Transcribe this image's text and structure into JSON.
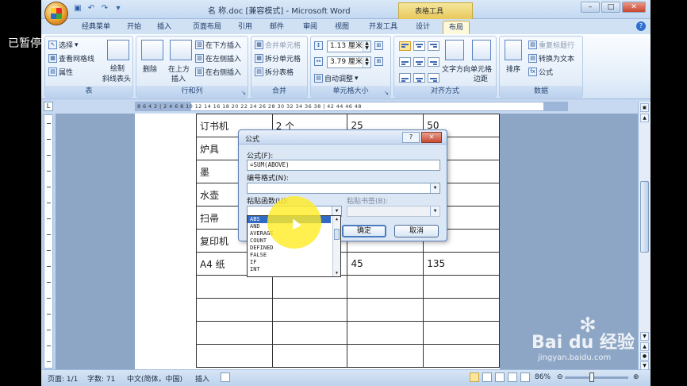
{
  "overlay": {
    "paused_label": "已暂停"
  },
  "window": {
    "title": "名 称.doc [兼容模式] - Microsoft Word",
    "tool_tab_label": "表格工具"
  },
  "tabs": [
    "经典菜单",
    "开始",
    "插入",
    "页面布局",
    "引用",
    "邮件",
    "审阅",
    "视图",
    "开发工具",
    "设计",
    "布局"
  ],
  "ribbon": {
    "table_group": {
      "caption": "表",
      "select": "选择",
      "gridlines": "查看网格线",
      "properties": "属性",
      "draw_diag": "绘制",
      "draw_diag2": "斜线表头"
    },
    "rowcol_group": {
      "caption": "行和列",
      "delete": "删除",
      "insert_above": "在上方",
      "insert_above2": "插入",
      "insert_below": "在下方插入",
      "insert_left": "在左侧插入",
      "insert_right": "在右侧插入"
    },
    "merge_group": {
      "caption": "合并",
      "merge_cells": "合并单元格",
      "split_cells": "拆分单元格",
      "split_table": "拆分表格"
    },
    "cellsize_group": {
      "caption": "单元格大小",
      "height": "1.13 厘米",
      "width": "3.79 厘米",
      "autofit": "自动调整"
    },
    "align_group": {
      "caption": "对齐方式",
      "text_dir": "文字方向",
      "margins": "单元格",
      "margins2": "边距"
    },
    "data_group": {
      "caption": "数据",
      "sort": "排序",
      "repeat_header": "重复标题行",
      "convert": "转换为文本",
      "formula": "公式"
    }
  },
  "ruler": {
    "h_numbers": "8  6  4  2  |  2  4  6  8  10  12  14  16  18  20  22  24  26  28  30  32  34  36  38  |  42  44  46  48"
  },
  "table": {
    "rows": [
      [
        "订书机",
        "2 个",
        "25",
        "50"
      ],
      [
        "炉具",
        "",
        "",
        ""
      ],
      [
        "墨",
        "",
        "",
        ""
      ],
      [
        "水壶",
        "",
        "",
        ""
      ],
      [
        "扫帚",
        "",
        "",
        ""
      ],
      [
        "复印机",
        "",
        "",
        ""
      ],
      [
        "A4 纸",
        "",
        "45",
        "135"
      ],
      [
        "",
        "",
        "",
        ""
      ],
      [
        "",
        "",
        "",
        ""
      ],
      [
        "",
        "",
        "",
        ""
      ],
      [
        "",
        "",
        "",
        ""
      ]
    ]
  },
  "dialog": {
    "title": "公式",
    "help": "?",
    "close": "✕",
    "formula_label": "公式(F):",
    "formula_value": "=SUM(ABOVE)",
    "number_format_label": "编号格式(N):",
    "paste_function_label": "粘贴函数(U):",
    "paste_bookmark_label": "粘贴书签(B):",
    "ok": "确定",
    "cancel": "取消",
    "functions": [
      "ABS",
      "AND",
      "AVERAGE",
      "COUNT",
      "DEFINED",
      "FALSE",
      "IF",
      "INT"
    ]
  },
  "status": {
    "page": "页面: 1/1",
    "words": "字数: 71",
    "lang": "中文(简体，中国)",
    "mode": "插入",
    "zoom": "86%",
    "zoom_fraction": 0.43
  },
  "watermark": {
    "brand": "Bai du 经验",
    "url": "jingyan.baidu.com"
  }
}
